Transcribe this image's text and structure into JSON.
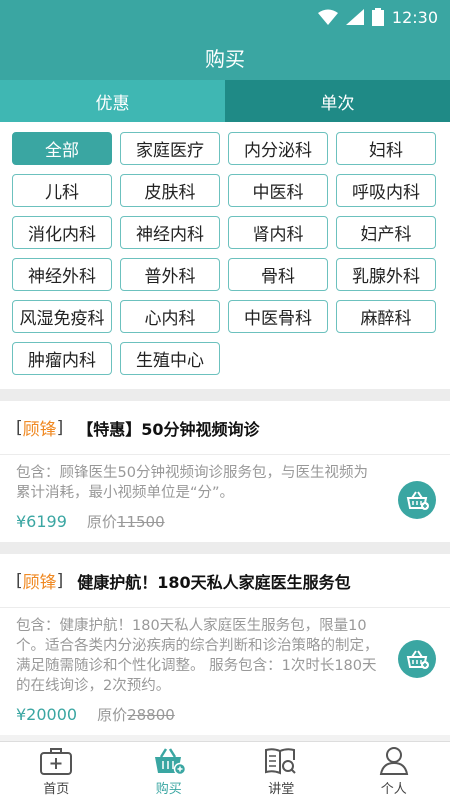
{
  "status": {
    "time": "12:30"
  },
  "header": {
    "title": "购买"
  },
  "tabs": [
    {
      "label": "优惠"
    },
    {
      "label": "单次"
    }
  ],
  "categories": [
    "全部",
    "家庭医疗",
    "内分泌科",
    "妇科",
    "儿科",
    "皮肤科",
    "中医科",
    "呼吸内科",
    "消化内科",
    "神经内科",
    "肾内科",
    "妇产科",
    "神经外科",
    "普外科",
    "骨科",
    "乳腺外科",
    "风湿免疫科",
    "心内科",
    "中医骨科",
    "麻醉科",
    "肿瘤内科",
    "生殖中心"
  ],
  "selected_category": "全部",
  "products": [
    {
      "brand": "顾锋",
      "title": "【特惠】50分钟视频询诊",
      "desc": "包含：顾锋医生50分钟视频询诊服务包，与医生视频为累计消耗，最小视频单位是“分”。",
      "price": "¥6199",
      "orig_label": "原价",
      "orig_price": "11500"
    },
    {
      "brand": "顾锋",
      "title": "健康护航！180天私人家庭医生服务包",
      "desc": "包含：健康护航！180天私人家庭医生服务包，限量10个。适合各类内分泌疾病的综合判断和诊治策略的制定，满足随需随诊和个性化调整。 服务包含：1次时长180天的在线询诊，2次预约。",
      "price": "¥20000",
      "orig_label": "原价",
      "orig_price": "28800"
    }
  ],
  "nav": [
    {
      "label": "首页",
      "icon": "medical-kit-icon"
    },
    {
      "label": "购买",
      "icon": "basket-icon"
    },
    {
      "label": "讲堂",
      "icon": "book-search-icon"
    },
    {
      "label": "个人",
      "icon": "person-icon"
    }
  ],
  "colors": {
    "accent": "#3aa6a2",
    "brand": "#f08a24",
    "tab_dark": "#1f8a86"
  }
}
